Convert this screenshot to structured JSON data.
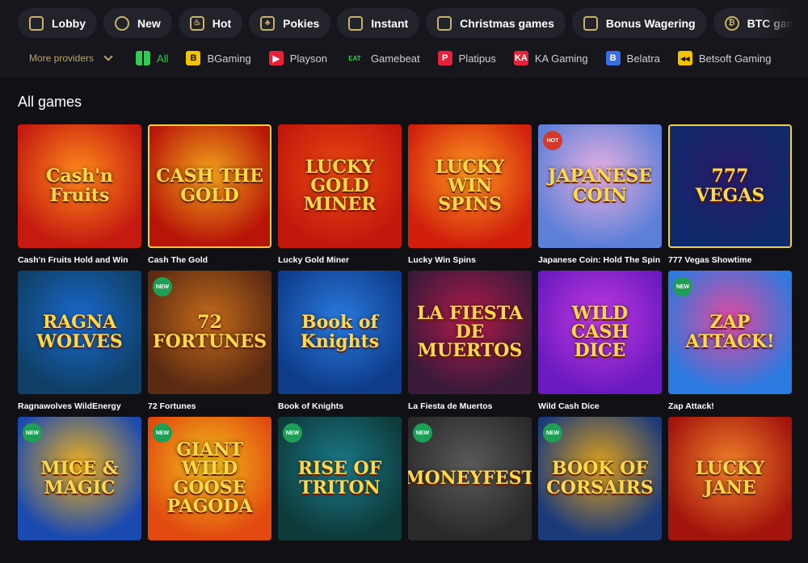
{
  "categories": [
    {
      "label": "Lobby",
      "icon": "slot-icon"
    },
    {
      "label": "New",
      "icon": "new-icon"
    },
    {
      "label": "Hot",
      "icon": "flame-icon"
    },
    {
      "label": "Pokies",
      "icon": "cherry-icon"
    },
    {
      "label": "Instant",
      "icon": "slot-icon"
    },
    {
      "label": "Christmas games",
      "icon": "slot-icon"
    },
    {
      "label": "Bonus Wagering",
      "icon": "slot-icon"
    },
    {
      "label": "BTC games",
      "icon": "bitcoin-icon"
    }
  ],
  "providers": {
    "more_label": "More providers",
    "items": [
      {
        "label": "All",
        "logo": "",
        "color": "#2ecc52",
        "active": true
      },
      {
        "label": "BGaming",
        "logo": "B",
        "color": "#f5c400"
      },
      {
        "label": "Playson",
        "logo": "▶",
        "color": "#e8203a"
      },
      {
        "label": "Gamebeat",
        "logo": "EAT",
        "color": "#2ecc52"
      },
      {
        "label": "Platipus",
        "logo": "P",
        "color": "#e8203a"
      },
      {
        "label": "KA Gaming",
        "logo": "KA",
        "color": "#e8203a"
      },
      {
        "label": "Belatra",
        "logo": "B",
        "color": "#3a6ee8"
      },
      {
        "label": "Betsoft Gaming",
        "logo": "◂◂",
        "color": "#f5c400"
      }
    ]
  },
  "section_title": "All games",
  "games": [
    {
      "name": "Cash'n Fruits Hold and Win",
      "art": "Cash'n Fruits",
      "bg": "#c41a10",
      "bg2": "#ff8a1a",
      "badge": ""
    },
    {
      "name": "Cash The Gold",
      "art": "CASH THE GOLD",
      "bg": "#b81508",
      "bg2": "#f2a41a",
      "badge": "",
      "bordered": true
    },
    {
      "name": "Lucky Gold Miner",
      "art": "LUCKY GOLD MINER",
      "bg": "#c2170d",
      "bg2": "#e84a10",
      "badge": ""
    },
    {
      "name": "Lucky Win Spins",
      "art": "LUCKY WIN SPINS",
      "bg": "#d11f0c",
      "bg2": "#ff9a1f",
      "badge": ""
    },
    {
      "name": "Japanese Coin: Hold The Spin",
      "art": "JAPANESE COIN",
      "bg": "#5d7fd8",
      "bg2": "#e9b0e0",
      "badge": "HOT"
    },
    {
      "name": "777 Vegas Showtime",
      "art": "777 VEGAS",
      "bg": "#0f2a6a",
      "bg2": "#2a1a6a",
      "badge": "",
      "bordered": true
    },
    {
      "name": "Ragnawolves WildEnergy",
      "art": "RAGNA WOLVES",
      "bg": "#0f3f66",
      "bg2": "#1a6ad0",
      "badge": ""
    },
    {
      "name": "72 Fortunes",
      "art": "72 FORTUNES",
      "bg": "#5a2a12",
      "bg2": "#c46a1a",
      "badge": "NEW"
    },
    {
      "name": "Book of Knights",
      "art": "Book of Knights",
      "bg": "#0e3c8a",
      "bg2": "#2a7be0",
      "badge": ""
    },
    {
      "name": "La Fiesta de Muertos",
      "art": "LA FIESTA DE MUERTOS",
      "bg": "#3a1a3a",
      "bg2": "#b01a4a",
      "badge": ""
    },
    {
      "name": "Wild Cash Dice",
      "art": "WILD CASH DICE",
      "bg": "#6a1ac0",
      "bg2": "#c23ae0",
      "badge": ""
    },
    {
      "name": "Zap Attack!",
      "art": "ZAP ATTACK!",
      "bg": "#2a7ae0",
      "bg2": "#e24aa0",
      "badge": "NEW"
    },
    {
      "name": "Mice & Magic",
      "art": "MICE & MAGIC",
      "bg": "#1a4ab0",
      "bg2": "#f2b21a",
      "badge": "NEW"
    },
    {
      "name": "Giant Wild Goose Pagoda",
      "art": "GIANT WILD GOOSE PAGODA",
      "bg": "#e24a10",
      "bg2": "#f2c21a",
      "badge": "NEW"
    },
    {
      "name": "Rise of Triton",
      "art": "RISE OF TRITON",
      "bg": "#0e3a3a",
      "bg2": "#1a7a8a",
      "badge": "NEW"
    },
    {
      "name": "Moneyfest",
      "art": "MONEYFEST",
      "bg": "#2a2a2a",
      "bg2": "#5a5a5a",
      "badge": "NEW"
    },
    {
      "name": "Book of Corsairs",
      "art": "BOOK OF CORSAIRS",
      "bg": "#1a3a7a",
      "bg2": "#e2a21a",
      "badge": "NEW"
    },
    {
      "name": "Lucky Jane",
      "art": "LUCKY JANE",
      "bg": "#a2140c",
      "bg2": "#f2822a",
      "badge": ""
    }
  ]
}
